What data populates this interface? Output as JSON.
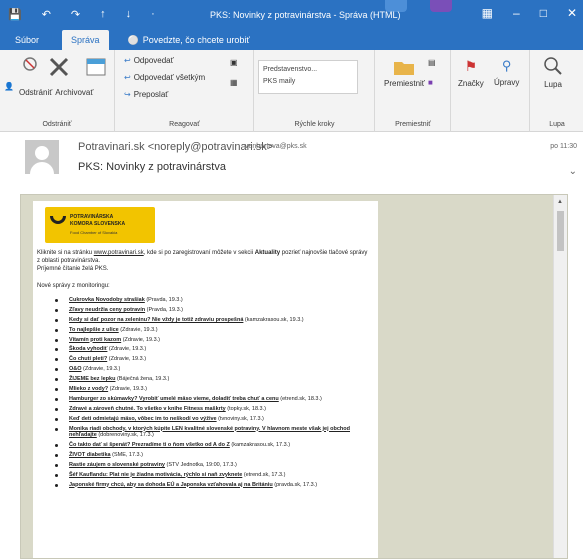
{
  "window": {
    "title": "PKS: Novinky z potravinárstva  -  Správa (HTML)"
  },
  "tabs": {
    "file": "Súbor",
    "message": "Správa",
    "tell_me": "Povedzte, čo chcete urobiť"
  },
  "ribbon": {
    "groups": {
      "delete": "Odstrániť",
      "respond": "Reagovať",
      "quick_steps": "Rýchle kroky",
      "move": "Premiestniť",
      "zoom": "Lupa"
    },
    "buttons": {
      "delete": "Odstrániť",
      "archive": "Archivovať",
      "reply": "Odpovedať",
      "reply_all": "Odpovedať všetkým",
      "forward": "Preposlať",
      "move": "Premiestniť",
      "tags": "Značky",
      "editing": "Úpravy",
      "zoom": "Lupa"
    },
    "quick_steps": [
      "Predstavenstvo...",
      "PKS maily"
    ]
  },
  "message": {
    "sender": "Potravinari.sk <noreply@potravinari.sk>",
    "to": "venhartova@pks.sk",
    "time": "po 11:30",
    "subject": "PKS: Novinky z potravinárstva"
  },
  "logo": {
    "line1": "POTRAVINÁRSKA",
    "line2": "KOMORA SLOVENSKA",
    "line3": "Food Chamber of Slovakia"
  },
  "intro": {
    "before_link": "Kliknite si na stránku ",
    "link": "www.potravinari.sk",
    "after_link": ", kde si po zaregistrovaní môžete v sekcii ",
    "section": "Aktuality",
    "after_section": " pozrieť najnovšie tlačové správy z oblasti potravinárstva.",
    "greeting": "Príjemné čítanie želá PKS."
  },
  "monitoring_label": "Nové správy z monitoringu:",
  "news": [
    {
      "title": "Cukrovka Novodoby strašiak",
      "source": " (Pravda, 19.3.)"
    },
    {
      "title": "Zľavy neudržia ceny potravín",
      "source": " (Pravda, 19.3.)"
    },
    {
      "title": "Kedy si dať pozor na zeleninu? Nie vždy je totiž zdraviu prospešná",
      "source": " (kamzakrasou.sk, 19.3.)"
    },
    {
      "title": "To najlepšie z ulice",
      "source": " (Zdravie, 19.3.)"
    },
    {
      "title": "Vitamín proti kazom",
      "source": " (Zdravie, 19.3.)"
    },
    {
      "title": "Škoda vyhodiť",
      "source": " (Zdravie, 19.3.)"
    },
    {
      "title": "Čo chutí pleti?",
      "source": " (Zdravie, 19.3.)"
    },
    {
      "title": "O&O",
      "source": " (Zdravie, 19.3.)"
    },
    {
      "title": "ŽIJEME bez lepku",
      "source": " (Báječná žena, 19.3.)"
    },
    {
      "title": "Mlieko z vody?",
      "source": " (Zdravie, 19.3.)"
    },
    {
      "title": "Hamburger zo skúmavky? Vyrobiť umelé mäso vieme, doladiť treba chuť a cenu",
      "source": " (etrend.sk, 18.3.)"
    },
    {
      "title": "Zdravé a zároveň chutné. To všetko v knihe Fitness maškrty",
      "source": " (topky.sk, 18.3.)"
    },
    {
      "title": "Keď deti odmietajú mäso, vôbec im to neškodí vo výživе",
      "source": " (tvnoviny.sk, 17.3.)"
    },
    {
      "title": "Monika riadi obchody, v ktorých kúpite LEN kvalitné slovenské potraviny. V hlavnom meste však jej obchod nehľadajte",
      "source": " (dobrenoviny.sk, 17.3.)"
    },
    {
      "title": "Čo takto dať si špenát? Prezradíme ti o ňom všetko od A do Z",
      "source": " (kamzakrasou.sk, 17.3.)"
    },
    {
      "title": "ŽIVOT diabetika",
      "source": " (SME, 17.3.)"
    },
    {
      "title": "Rastie záujem o slovenské potraviny",
      "source": " (STV Jednotka, 19:00, 17.3.)"
    },
    {
      "title": "Šéf Kauflandu: Plat nie je žiadna motivácia, rýchlo si naň zvyknete",
      "source": " (etrend.sk, 17.3.)"
    },
    {
      "title": "Japonské firmy chcú, aby sa dohoda EÚ a Japonska vzťahovala aj na Britániu",
      "source": " (pravda.sk, 17.3.)"
    }
  ]
}
